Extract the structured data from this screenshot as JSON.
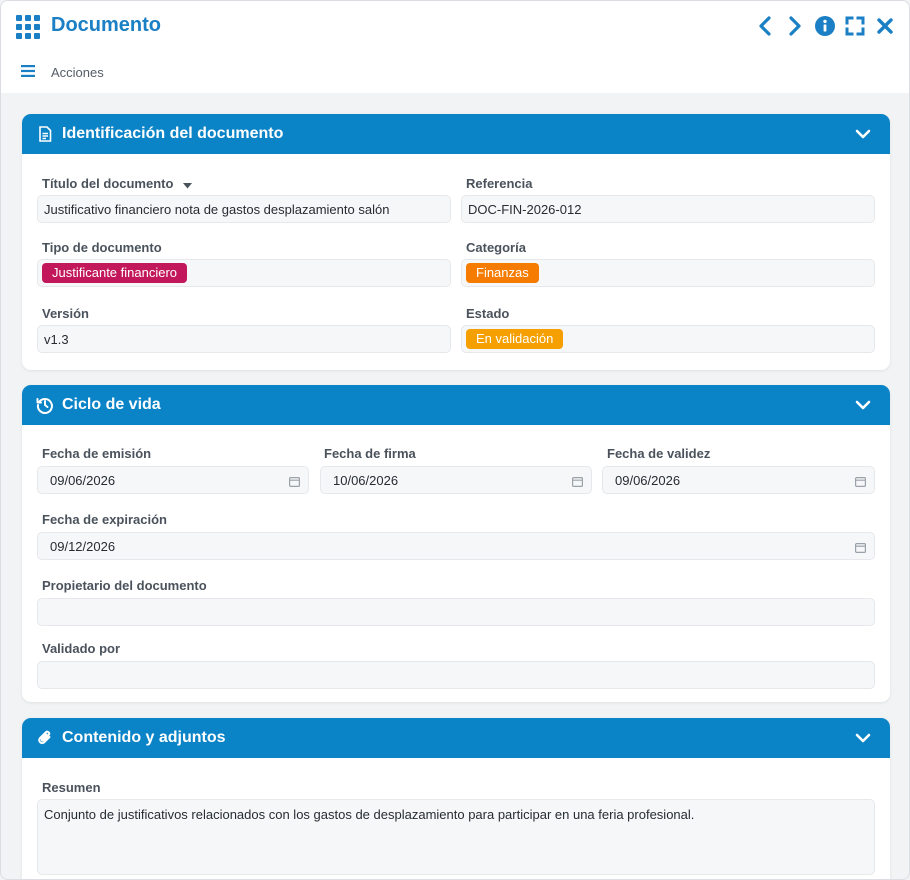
{
  "window": {
    "title": "Documento"
  },
  "menu": {
    "label": "Acciones"
  },
  "sections": {
    "identificacion": {
      "title": "Identificación del documento",
      "titulo_label": "Título del documento",
      "titulo_value": "Justificativo financiero nota de gastos desplazamiento salón",
      "referencia_label": "Referencia",
      "referencia_value": "DOC-FIN-2026-012",
      "tipo_label": "Tipo de documento",
      "tipo_value": "Justificante financiero",
      "tipo_color": "#c2185b",
      "categoria_label": "Categoría",
      "categoria_value": "Finanzas",
      "categoria_color": "#f57c00",
      "version_label": "Versión",
      "version_value": "v1.3",
      "estado_label": "Estado",
      "estado_value": "En validación",
      "estado_color": "#f5a000"
    },
    "ciclo": {
      "title": "Ciclo de vida",
      "emision_label": "Fecha de emisión",
      "emision_value": "09/06/2026",
      "firma_label": "Fecha de firma",
      "firma_value": "10/06/2026",
      "validez_label": "Fecha de validez",
      "validez_value": "09/06/2026",
      "expiracion_label": "Fecha de expiración",
      "expiracion_value": "09/12/2026",
      "propietario_label": "Propietario del documento",
      "propietario_value": "",
      "validado_label": "Validado por",
      "validado_value": ""
    },
    "contenido": {
      "title": "Contenido y adjuntos",
      "resumen_label": "Resumen",
      "resumen_value": "Conjunto de justificativos relacionados con los gastos de desplazamiento para participar en una feria profesional."
    }
  },
  "colors": {
    "accent": "#0a83c7",
    "title": "#1a7fc4"
  },
  "icons": [
    "apps-grid-icon",
    "chevron-left-icon",
    "chevron-right-icon",
    "info-icon",
    "fullscreen-icon",
    "close-icon",
    "hamburger-icon",
    "document-icon",
    "history-icon",
    "paperclip-icon",
    "chevron-down-icon",
    "calendar-icon",
    "caret-down-icon"
  ]
}
